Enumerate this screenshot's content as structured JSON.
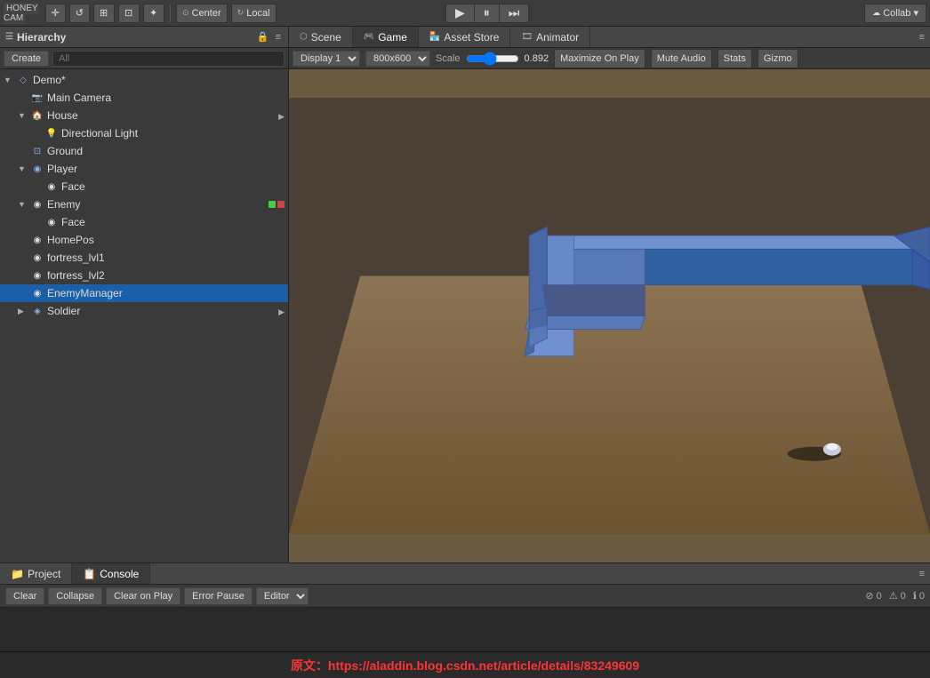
{
  "app": {
    "title": "HONEYCAM",
    "logo": "🎬"
  },
  "toolbar": {
    "tools": [
      "✛",
      "↺",
      "⊞",
      "⊡",
      "⊛"
    ],
    "pivot_center": "Center",
    "pivot_local": "Local",
    "play_label": "▶",
    "pause_label": "⏸",
    "step_label": "⏭",
    "collab_label": "Collab ▾"
  },
  "hierarchy": {
    "title": "Hierarchy",
    "create_label": "Create",
    "search_placeholder": "All",
    "items": [
      {
        "id": "demo",
        "label": "Demo*",
        "indent": 0,
        "arrow": "down",
        "icon": "◇",
        "selected": false
      },
      {
        "id": "main-camera",
        "label": "Main Camera",
        "indent": 1,
        "arrow": "none",
        "icon": "📷",
        "selected": false
      },
      {
        "id": "house",
        "label": "House",
        "indent": 1,
        "arrow": "down",
        "icon": "🏠",
        "selected": false
      },
      {
        "id": "directional-light",
        "label": "Directional Light",
        "indent": 2,
        "arrow": "none",
        "icon": "💡",
        "selected": false
      },
      {
        "id": "ground",
        "label": "Ground",
        "indent": 1,
        "arrow": "none",
        "icon": "⊡",
        "selected": false
      },
      {
        "id": "player",
        "label": "Player",
        "indent": 1,
        "arrow": "down",
        "icon": "◉",
        "selected": false
      },
      {
        "id": "face-player",
        "label": "Face",
        "indent": 2,
        "arrow": "none",
        "icon": "◉",
        "selected": false
      },
      {
        "id": "enemy",
        "label": "Enemy",
        "indent": 1,
        "arrow": "down",
        "icon": "◉",
        "selected": false
      },
      {
        "id": "face-enemy",
        "label": "Face",
        "indent": 2,
        "arrow": "none",
        "icon": "◉",
        "selected": false
      },
      {
        "id": "homepos",
        "label": "HomePos",
        "indent": 1,
        "arrow": "none",
        "icon": "◉",
        "selected": false
      },
      {
        "id": "fortress1",
        "label": "fortress_lvl1",
        "indent": 1,
        "arrow": "none",
        "icon": "◉",
        "selected": false
      },
      {
        "id": "fortress2",
        "label": "fortress_lvl2",
        "indent": 1,
        "arrow": "none",
        "icon": "◉",
        "selected": false
      },
      {
        "id": "enemymanager",
        "label": "EnemyManager",
        "indent": 1,
        "arrow": "none",
        "icon": "◉",
        "selected": true
      },
      {
        "id": "soldier",
        "label": "Soldier",
        "indent": 1,
        "arrow": "right",
        "icon": "◈",
        "selected": false
      }
    ]
  },
  "tabs": {
    "scene_label": "Scene",
    "game_label": "Game",
    "asset_store_label": "Asset Store",
    "animator_label": "Animator"
  },
  "game_toolbar": {
    "display_label": "Display 1",
    "resolution_label": "800x600",
    "scale_label": "Scale",
    "scale_value": "0.892",
    "maximize_label": "Maximize On Play",
    "mute_label": "Mute Audio",
    "stats_label": "Stats",
    "gizmo_label": "Gizmo"
  },
  "bottom": {
    "project_label": "Project",
    "console_label": "Console",
    "clear_label": "Clear",
    "collapse_label": "Collapse",
    "clear_on_play_label": "Clear on Play",
    "error_pause_label": "Error Pause",
    "editor_label": "Editor",
    "error_count": "0",
    "warning_count": "0",
    "info_count": "0"
  },
  "watermark": {
    "text": "原文：https://aladdin.blog.csdn.net/article/details/83249609",
    "url": "https://aladdin.blog.csdn.net/article/details/83249609"
  }
}
